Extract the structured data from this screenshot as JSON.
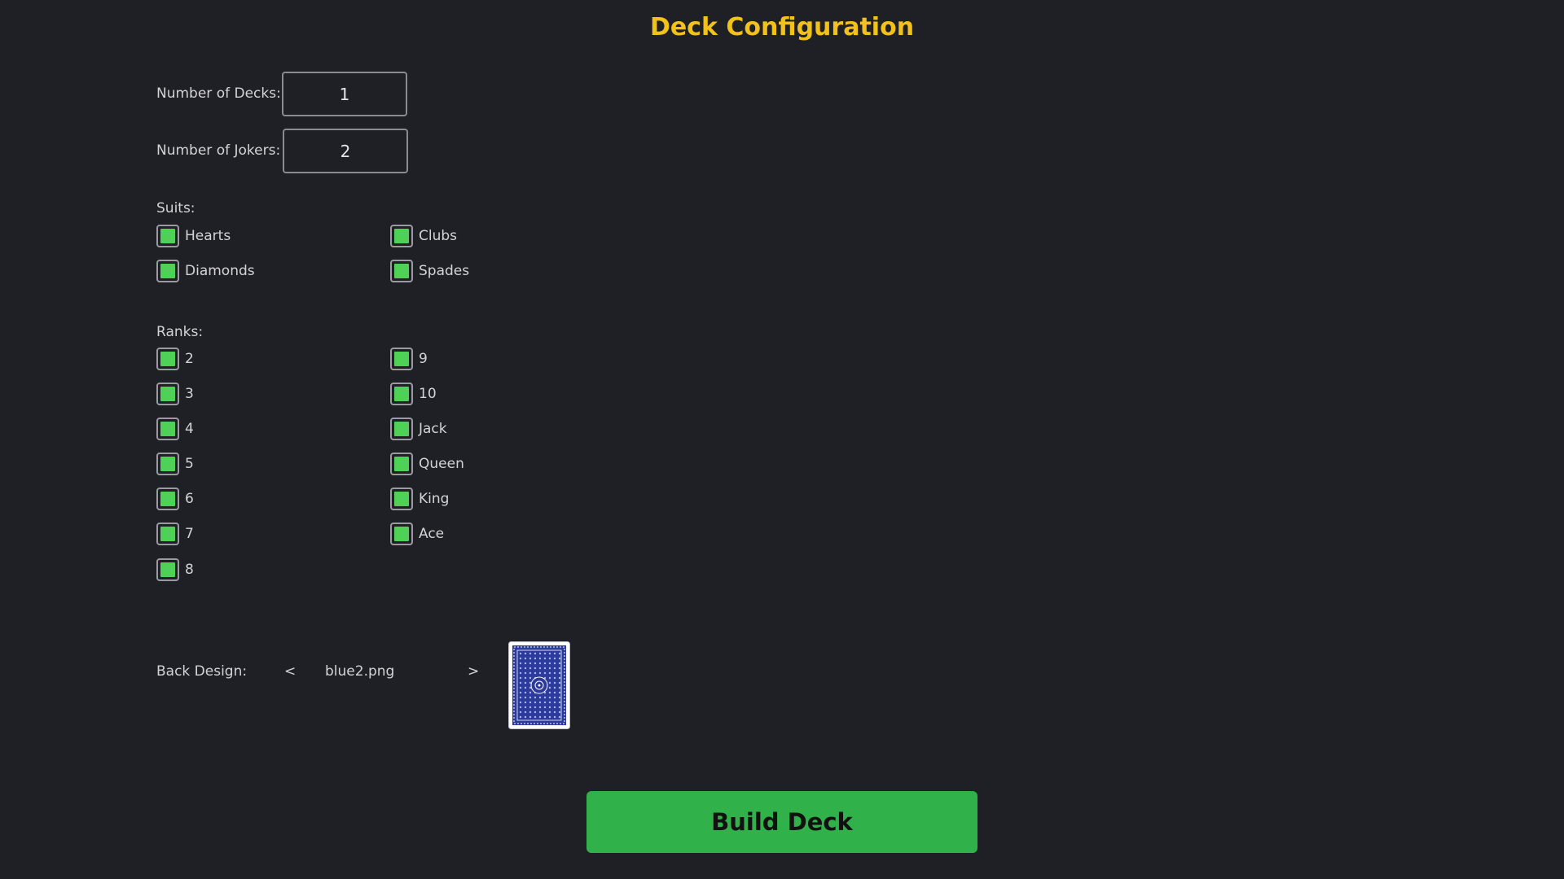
{
  "title": "Deck Configuration",
  "num_decks": {
    "label": "Number of Decks:",
    "value": "1"
  },
  "num_jokers": {
    "label": "Number of Jokers:",
    "value": "2"
  },
  "suits": {
    "label": "Suits:",
    "items": [
      {
        "label": "Hearts",
        "checked": true
      },
      {
        "label": "Clubs",
        "checked": true
      },
      {
        "label": "Diamonds",
        "checked": true
      },
      {
        "label": "Spades",
        "checked": true
      }
    ]
  },
  "ranks": {
    "label": "Ranks:",
    "items": [
      {
        "label": "2",
        "checked": true
      },
      {
        "label": "3",
        "checked": true
      },
      {
        "label": "4",
        "checked": true
      },
      {
        "label": "5",
        "checked": true
      },
      {
        "label": "6",
        "checked": true
      },
      {
        "label": "7",
        "checked": true
      },
      {
        "label": "8",
        "checked": true
      },
      {
        "label": "9",
        "checked": true
      },
      {
        "label": "10",
        "checked": true
      },
      {
        "label": "Jack",
        "checked": true
      },
      {
        "label": "Queen",
        "checked": true
      },
      {
        "label": "King",
        "checked": true
      },
      {
        "label": "Ace",
        "checked": true
      }
    ]
  },
  "back_design": {
    "label": "Back Design:",
    "prev": "<",
    "next": ">",
    "filename": "blue2.png"
  },
  "build_button": "Build Deck",
  "colors": {
    "background": "#1f1f26",
    "title": "#f2c21a",
    "checkbox_fill": "#4fd056",
    "button": "#31b14a",
    "card_blue": "#2c3a9c"
  }
}
